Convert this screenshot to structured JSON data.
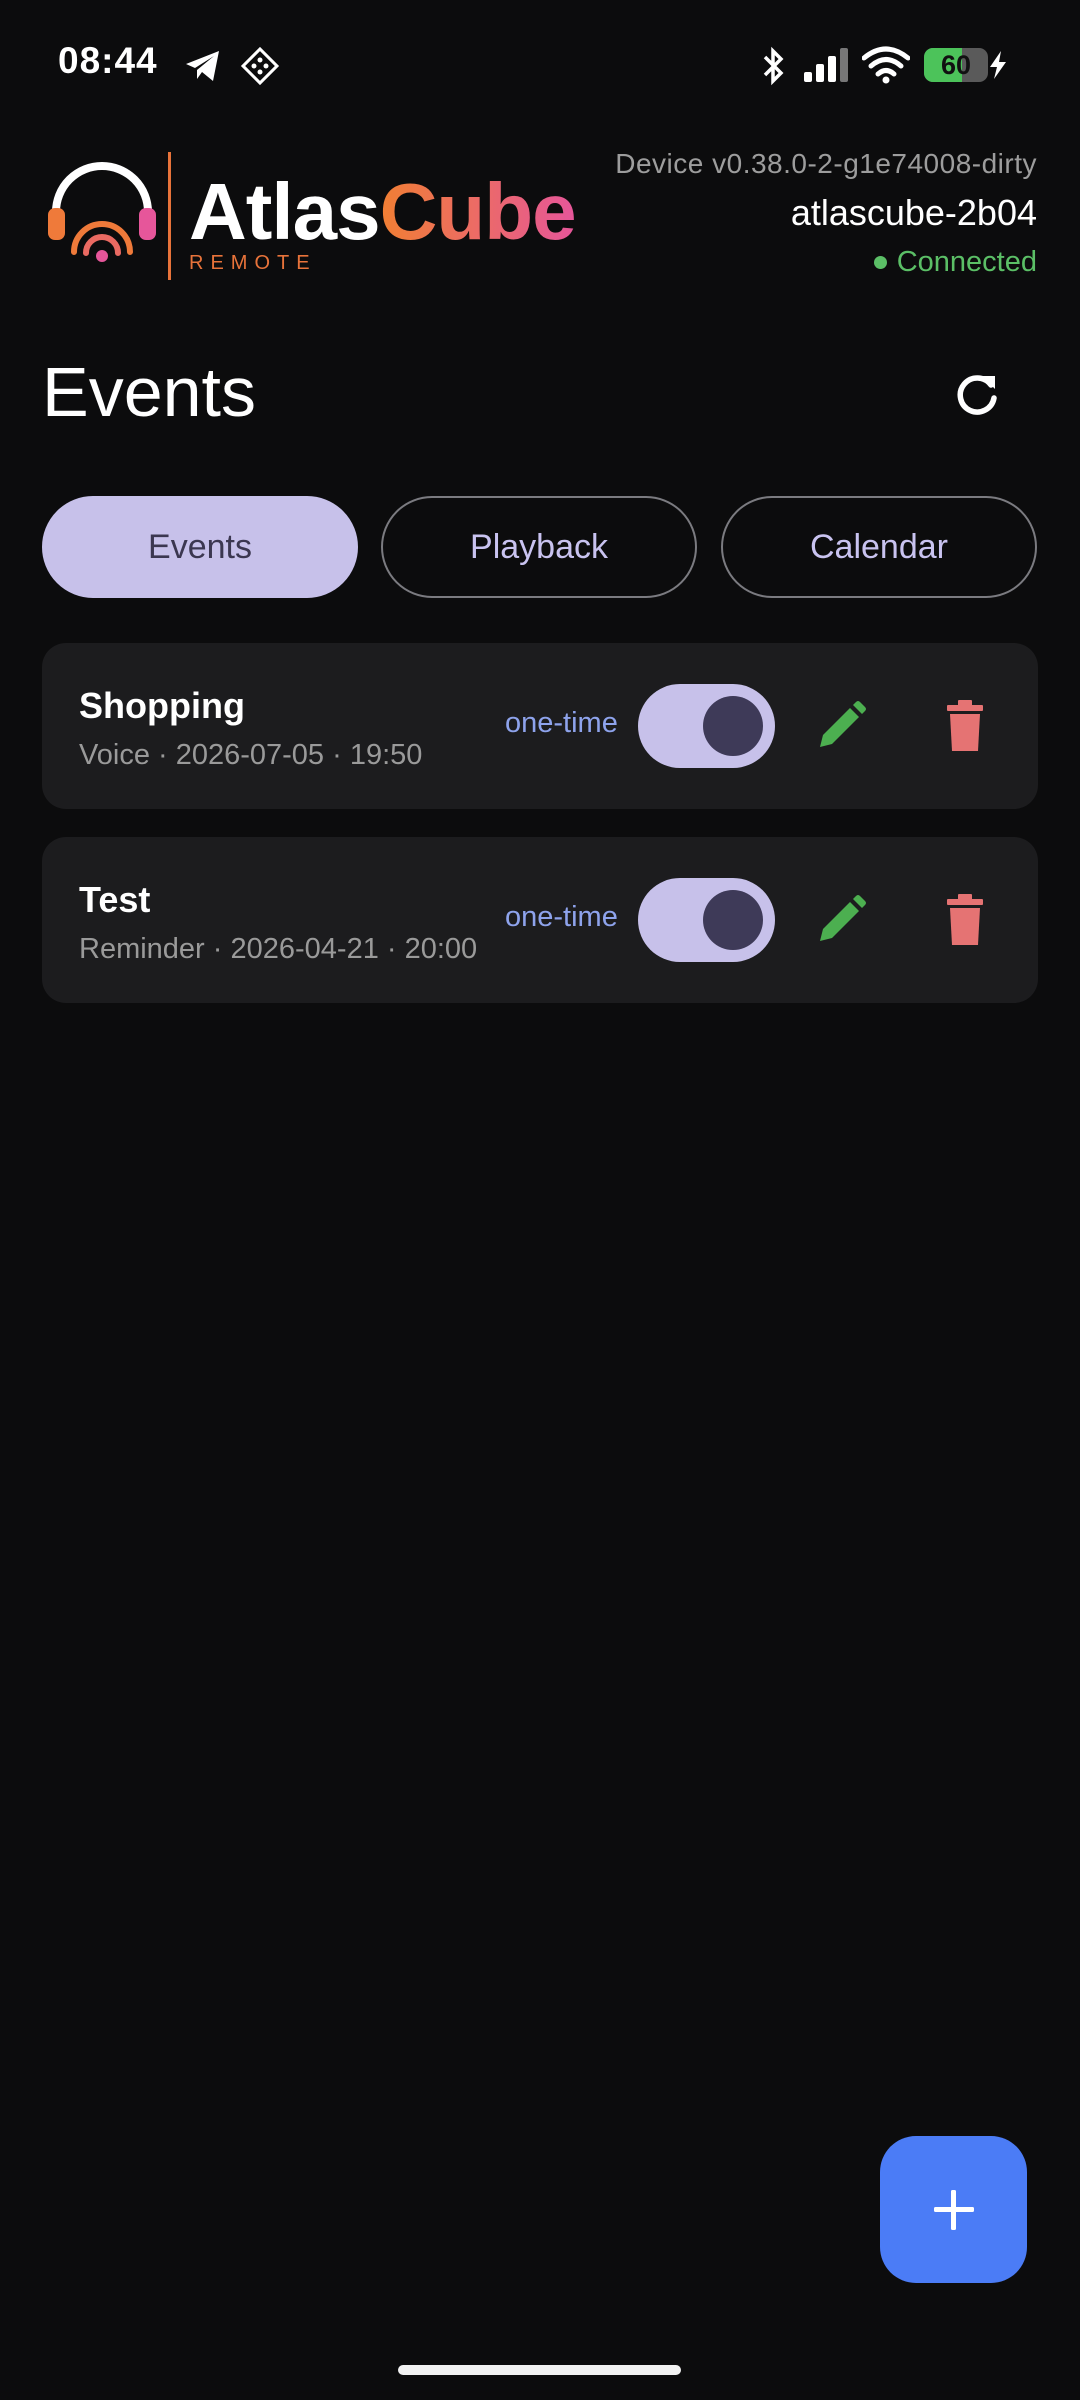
{
  "status_bar": {
    "time": "08:44",
    "battery": 60,
    "icons": [
      "telegram-icon",
      "app-icon",
      "bluetooth-icon",
      "signal-icon",
      "wifi-icon",
      "battery-icon",
      "charging-icon"
    ]
  },
  "header": {
    "brand_part1": "Atlas",
    "brand_part2": "Cube",
    "brand_sub": "REMOTE",
    "device_version": "Device v0.38.0-2-g1e74008-dirty",
    "device_name": "atlascube-2b04",
    "connection_status": "Connected"
  },
  "page": {
    "title": "Events"
  },
  "tabs": [
    {
      "label": "Events",
      "active": true
    },
    {
      "label": "Playback",
      "active": false
    },
    {
      "label": "Calendar",
      "active": false
    }
  ],
  "events": [
    {
      "title": "Shopping",
      "subtitle": "Voice · 2026-07-05 · 19:50",
      "kind": "one-time",
      "enabled": true
    },
    {
      "title": "Test",
      "subtitle": "Reminder · 2026-04-21 · 20:00",
      "kind": "one-time",
      "enabled": true
    }
  ],
  "colors": {
    "background": "#0c0c0d",
    "card": "#1c1c1e",
    "accent_lavender": "#c7c1ea",
    "connected_green": "#5bbf66",
    "edit_green": "#4caf50",
    "delete_red": "#e57373",
    "fab_blue": "#4b7cf6",
    "brand_orange": "#f17f33",
    "brand_pink": "#e6569a"
  }
}
